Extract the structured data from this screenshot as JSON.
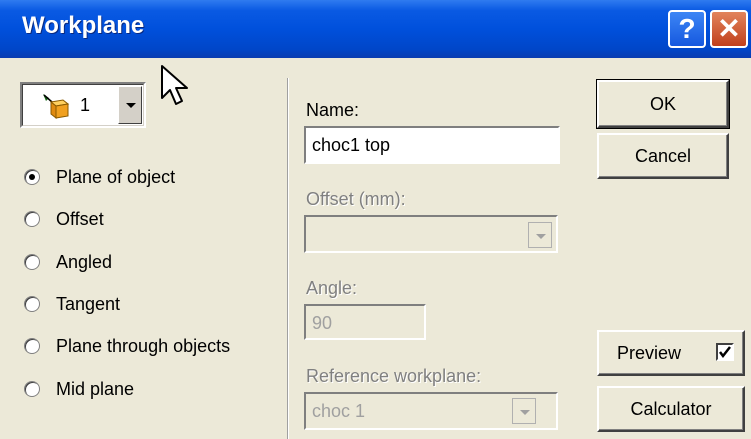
{
  "window": {
    "title": "Workplane",
    "help_glyph": "?",
    "close_glyph": "✕"
  },
  "object_selector": {
    "value": "1",
    "icon": "workplane-object-icon"
  },
  "mode_options": [
    {
      "label": "Plane of object",
      "checked": true
    },
    {
      "label": "Offset",
      "checked": false
    },
    {
      "label": "Angled",
      "checked": false
    },
    {
      "label": "Tangent",
      "checked": false
    },
    {
      "label": "Plane through objects",
      "checked": false
    },
    {
      "label": "Mid plane",
      "checked": false
    }
  ],
  "fields": {
    "name_label": "Name:",
    "name_value": "choc1 top",
    "offset_label": "Offset (mm):",
    "offset_value": "",
    "angle_label": "Angle:",
    "angle_value": "90",
    "reference_label": "Reference workplane:",
    "reference_value": "choc 1"
  },
  "buttons": {
    "ok": "OK",
    "cancel": "Cancel",
    "preview": "Preview",
    "calculator": "Calculator"
  },
  "preview_checked": true,
  "colors": {
    "titlebar": "#0050dc",
    "dialog_bg": "#ece9d8",
    "close_button": "#c1401c"
  }
}
